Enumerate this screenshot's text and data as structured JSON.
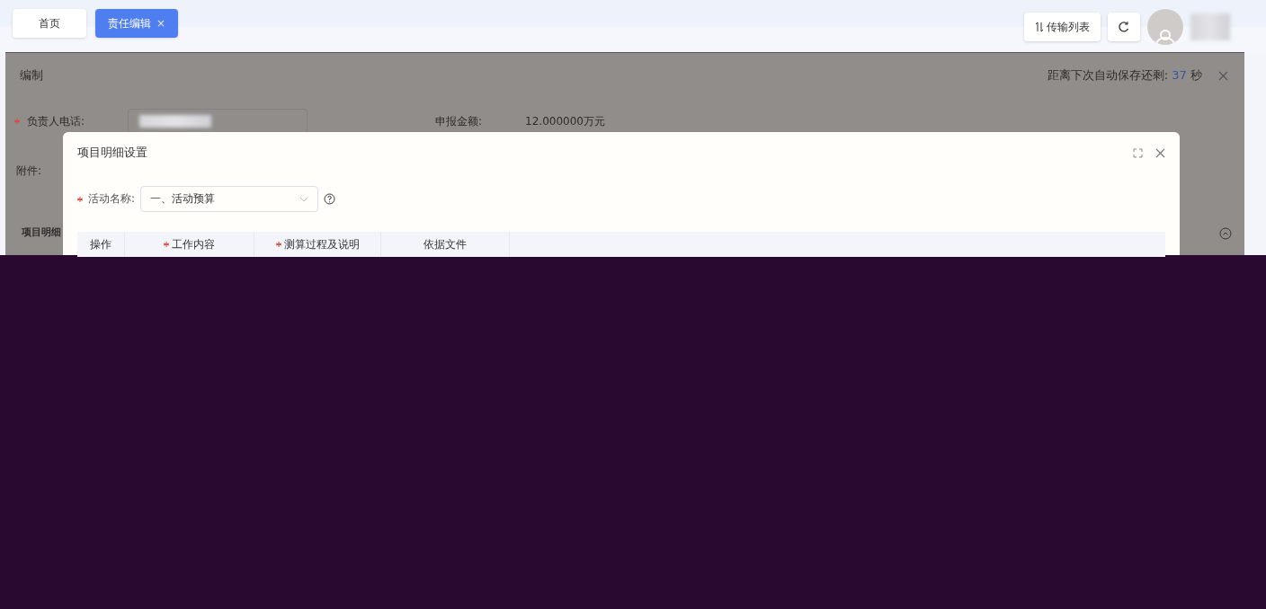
{
  "tabs": [
    {
      "label": "首页",
      "selected": false
    },
    {
      "label": "责任编辑",
      "selected": true,
      "close": "×"
    }
  ],
  "toolbar": {
    "transfer_button": "传输列表"
  },
  "page": {
    "title": "编制",
    "autosave": {
      "prefix": "距离下次自动保存还剩:",
      "seconds": "37",
      "unit": "秒"
    },
    "phone": {
      "label": "负责人电话:",
      "required": true
    },
    "amount": {
      "label": "申报金额:",
      "value": "12.000000万元"
    },
    "attachment_label": "附件:",
    "section_title": "项目明细"
  },
  "modal": {
    "title": "项目明细设置",
    "activity": {
      "label": "活动名称:",
      "required": true,
      "value": "一、活动预算"
    },
    "columns": [
      {
        "label": "操作",
        "required": false
      },
      {
        "label": "工作内容",
        "required": true
      },
      {
        "label": "测算过程及说明",
        "required": true
      },
      {
        "label": "依据文件",
        "required": false
      }
    ]
  }
}
